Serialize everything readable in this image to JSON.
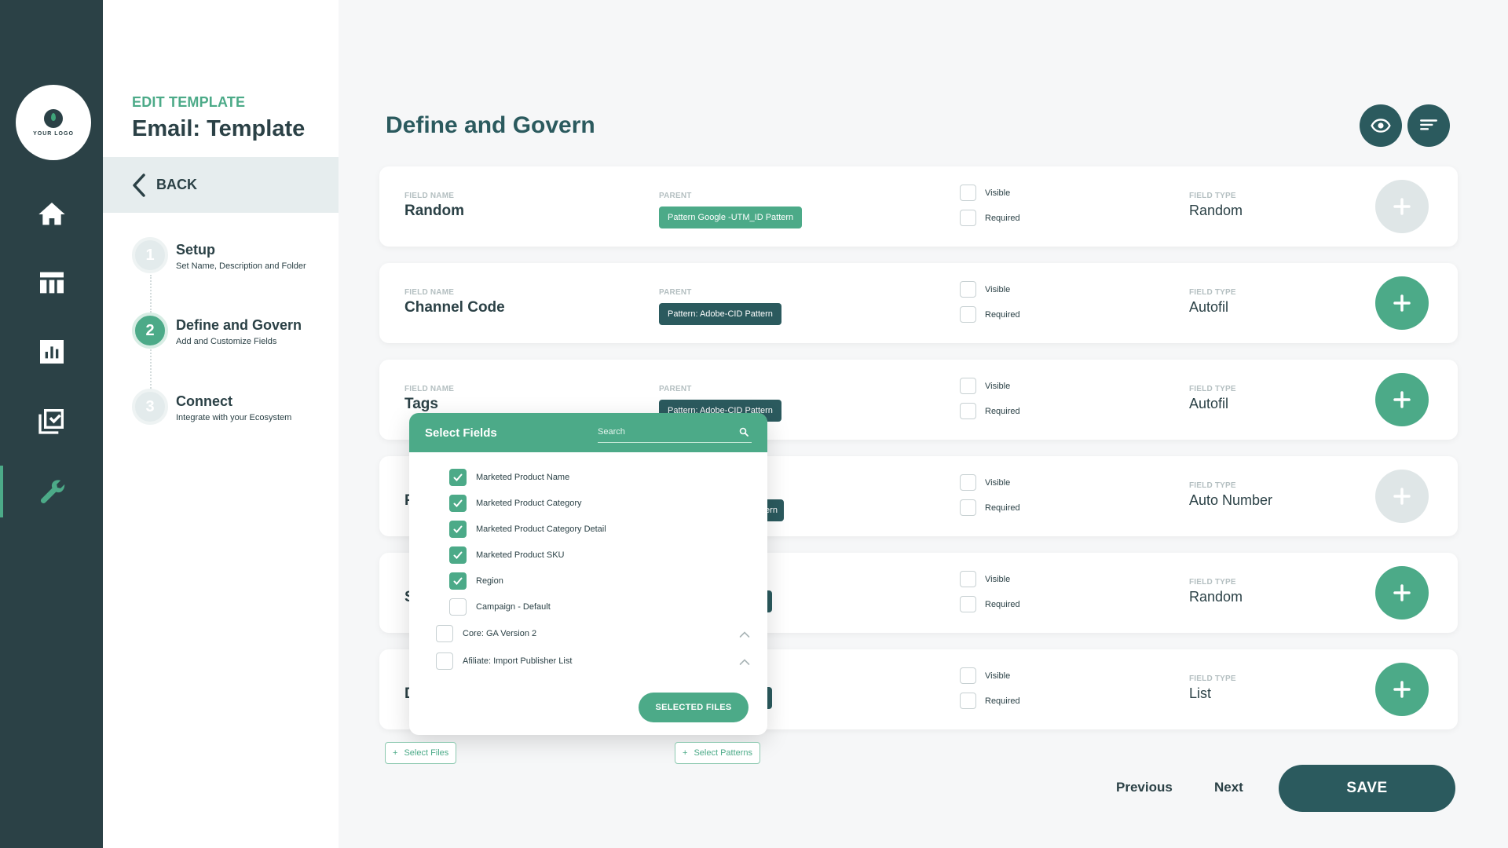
{
  "logo": {
    "text": "YOUR LOGO"
  },
  "rail": {
    "items": [
      {
        "name": "home-icon"
      },
      {
        "name": "table-icon"
      },
      {
        "name": "chart-icon"
      },
      {
        "name": "checklist-icon"
      },
      {
        "name": "wrench-icon",
        "active": true
      }
    ]
  },
  "template": {
    "edit_label": "EDIT TEMPLATE",
    "title": "Email: Template",
    "back_label": "BACK"
  },
  "steps": [
    {
      "number": "1",
      "title": "Setup",
      "subtitle": "Set Name, Description and Folder"
    },
    {
      "number": "2",
      "title": "Define and Govern",
      "subtitle": "Add and Customize Fields"
    },
    {
      "number": "3",
      "title": "Connect",
      "subtitle": "Integrate with your Ecosystem"
    }
  ],
  "main": {
    "title": "Define and Govern"
  },
  "labels": {
    "field_name": "FIELD NAME",
    "parent": "PARENT",
    "field_type": "FIELD TYPE",
    "visible": "Visible",
    "required": "Required"
  },
  "fields": [
    {
      "name": "Random",
      "parent": "Pattern Google -UTM_ID Pattern",
      "type": "Random"
    },
    {
      "name": "Channel Code",
      "parent": "Pattern: Adobe-CID Pattern",
      "type": "Autofil"
    },
    {
      "name": "Tags",
      "parent": "Pattern: Adobe-CID Pattern",
      "type": "Autofil"
    },
    {
      "name": "F",
      "parent": "tern",
      "type": "Auto Number"
    },
    {
      "name": "S",
      "parent": "s",
      "type": "Random"
    },
    {
      "name": "D",
      "parent": "s",
      "type": "List"
    }
  ],
  "popup": {
    "title": "Select Fields",
    "search_placeholder": "Search",
    "items": [
      {
        "label": "Marketed Product Name",
        "checked": true
      },
      {
        "label": "Marketed Product Category",
        "checked": true
      },
      {
        "label": "Marketed Product Category Detail",
        "checked": true
      },
      {
        "label": "Marketed Product SKU",
        "checked": true
      },
      {
        "label": "Region",
        "checked": true
      },
      {
        "label": "Campaign - Default",
        "checked": false
      }
    ],
    "groups": [
      {
        "label": "Core: GA Version 2"
      },
      {
        "label": "Afiliate: Import Publisher List"
      }
    ],
    "button_label": "SELECTED FILES"
  },
  "actions": {
    "select_files": "Select Files",
    "select_patterns": "Select Patterns",
    "previous": "Previous",
    "next": "Next",
    "save": "SAVE"
  },
  "colors": {
    "rail": "#2b4146",
    "accent": "#4caa88",
    "primary_dark": "#2b5a5e"
  }
}
